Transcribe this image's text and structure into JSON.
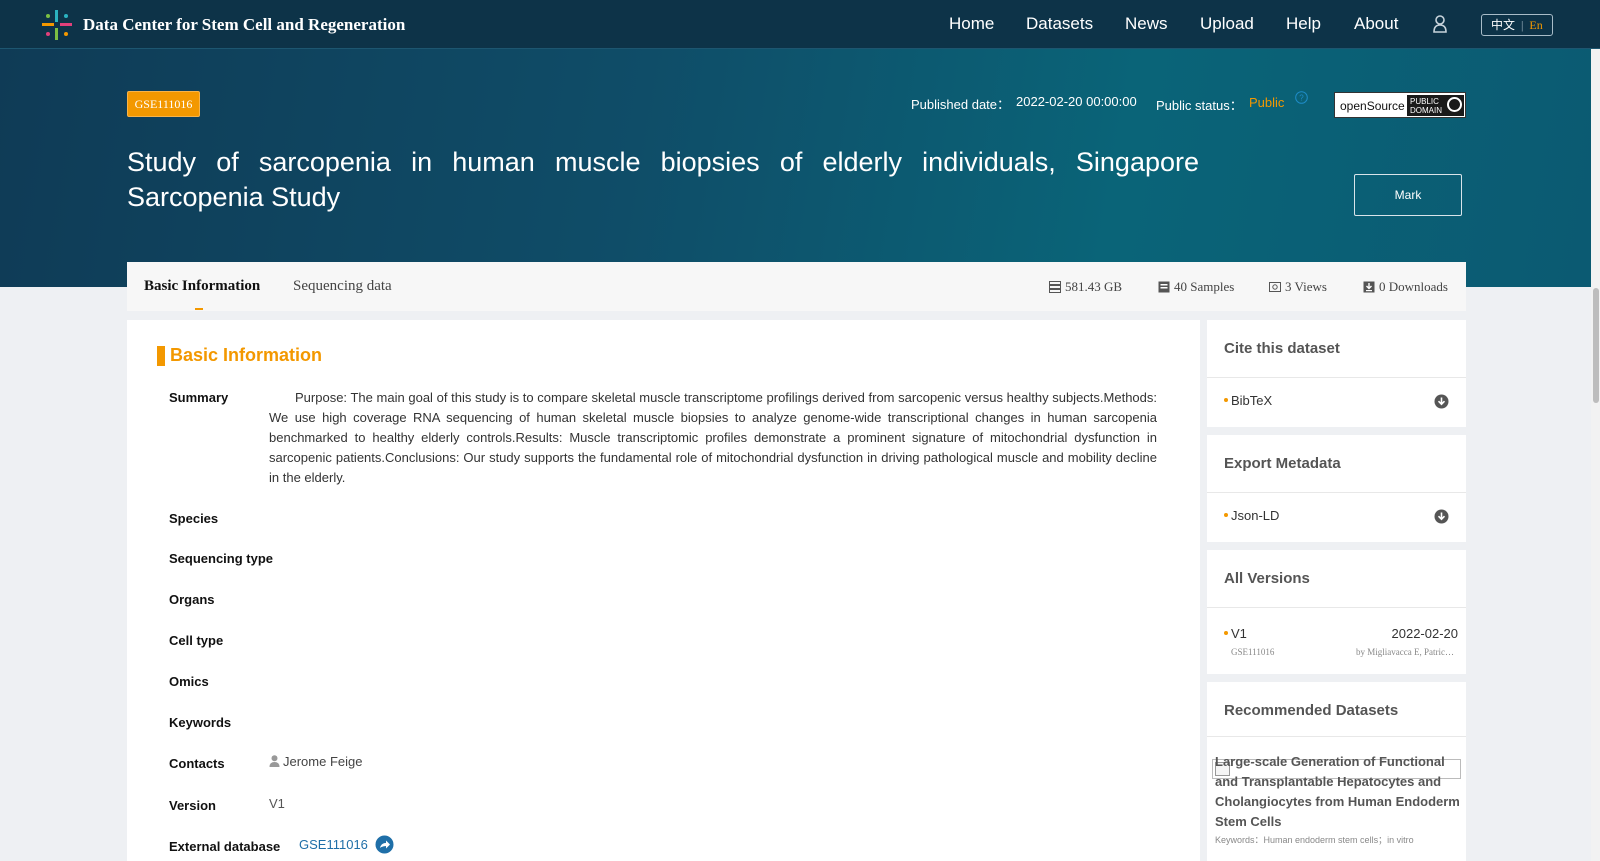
{
  "navbar": {
    "brand": "Data Center for Stem Cell and Regeneration",
    "links": [
      "Home",
      "Datasets",
      "News",
      "Upload",
      "Help",
      "About"
    ],
    "lang_zh": "中文",
    "lang_en": "En",
    "bg_color": "#0d3348"
  },
  "hero": {
    "accession": "GSE111016",
    "published_label": "Published date：",
    "published_date": "2022-02-20 00:00:00",
    "status_label": "Public status：",
    "status_value": "Public",
    "license_label": "openSource",
    "license_badge_line1": "PUBLIC",
    "license_badge_line2": "DOMAIN",
    "title": "Study of sarcopenia in human muscle biopsies of elderly individuals, Singapore Sarcopenia Study",
    "mark_button": "Mark",
    "accent_color": "#f39800"
  },
  "tabs": {
    "active": "Basic Information",
    "second": "Sequencing data"
  },
  "stats": {
    "size": "581.43 GB",
    "samples": "40 Samples",
    "views": "3 Views",
    "downloads": "0 Downloads"
  },
  "basic": {
    "section_title": "Basic Information",
    "labels": {
      "summary": "Summary",
      "species": "Species",
      "sequencing_type": "Sequencing type",
      "organs": "Organs",
      "cell_type": "Cell type",
      "omics": "Omics",
      "keywords": "Keywords",
      "contacts": "Contacts",
      "version": "Version",
      "external_database": "External database"
    },
    "summary": "Purpose: The main goal of this study is to compare skeletal muscle transcriptome profilings derived from sarcopenic versus healthy subjects.Methods: We use high coverage RNA sequencing of human skeletal muscle biopsies to analyze genome-wide transcriptional changes in human sarcopenia benchmarked to healthy elderly controls.Results: Muscle transcriptomic profiles demonstrate a prominent signature of mitochondrial dysfunction in sarcopenic patients.Conclusions: Our study supports the fundamental role of mitochondrial dysfunction in driving pathological muscle and mobility decline in the elderly.",
    "contact": "Jerome Feige",
    "version": "V1",
    "external_db": "GSE111016"
  },
  "sidebar": {
    "cite_title": "Cite this dataset",
    "cite_item": "BibTeX",
    "export_title": "Export Metadata",
    "export_item": "Json-LD",
    "versions_title": "All Versions",
    "version_name": "V1",
    "version_date": "2022-02-20",
    "version_id": "GSE111016",
    "version_by": "by Migliavacca E, Patric…",
    "recommended_title": "Recommended Datasets",
    "rec_title": "Large-scale Generation of Functional and Transplantable Hepatocytes and Cholangiocytes from Human Endoderm Stem Cells",
    "rec_keywords": "Keywords：Human endoderm stem cells；in vitro"
  }
}
